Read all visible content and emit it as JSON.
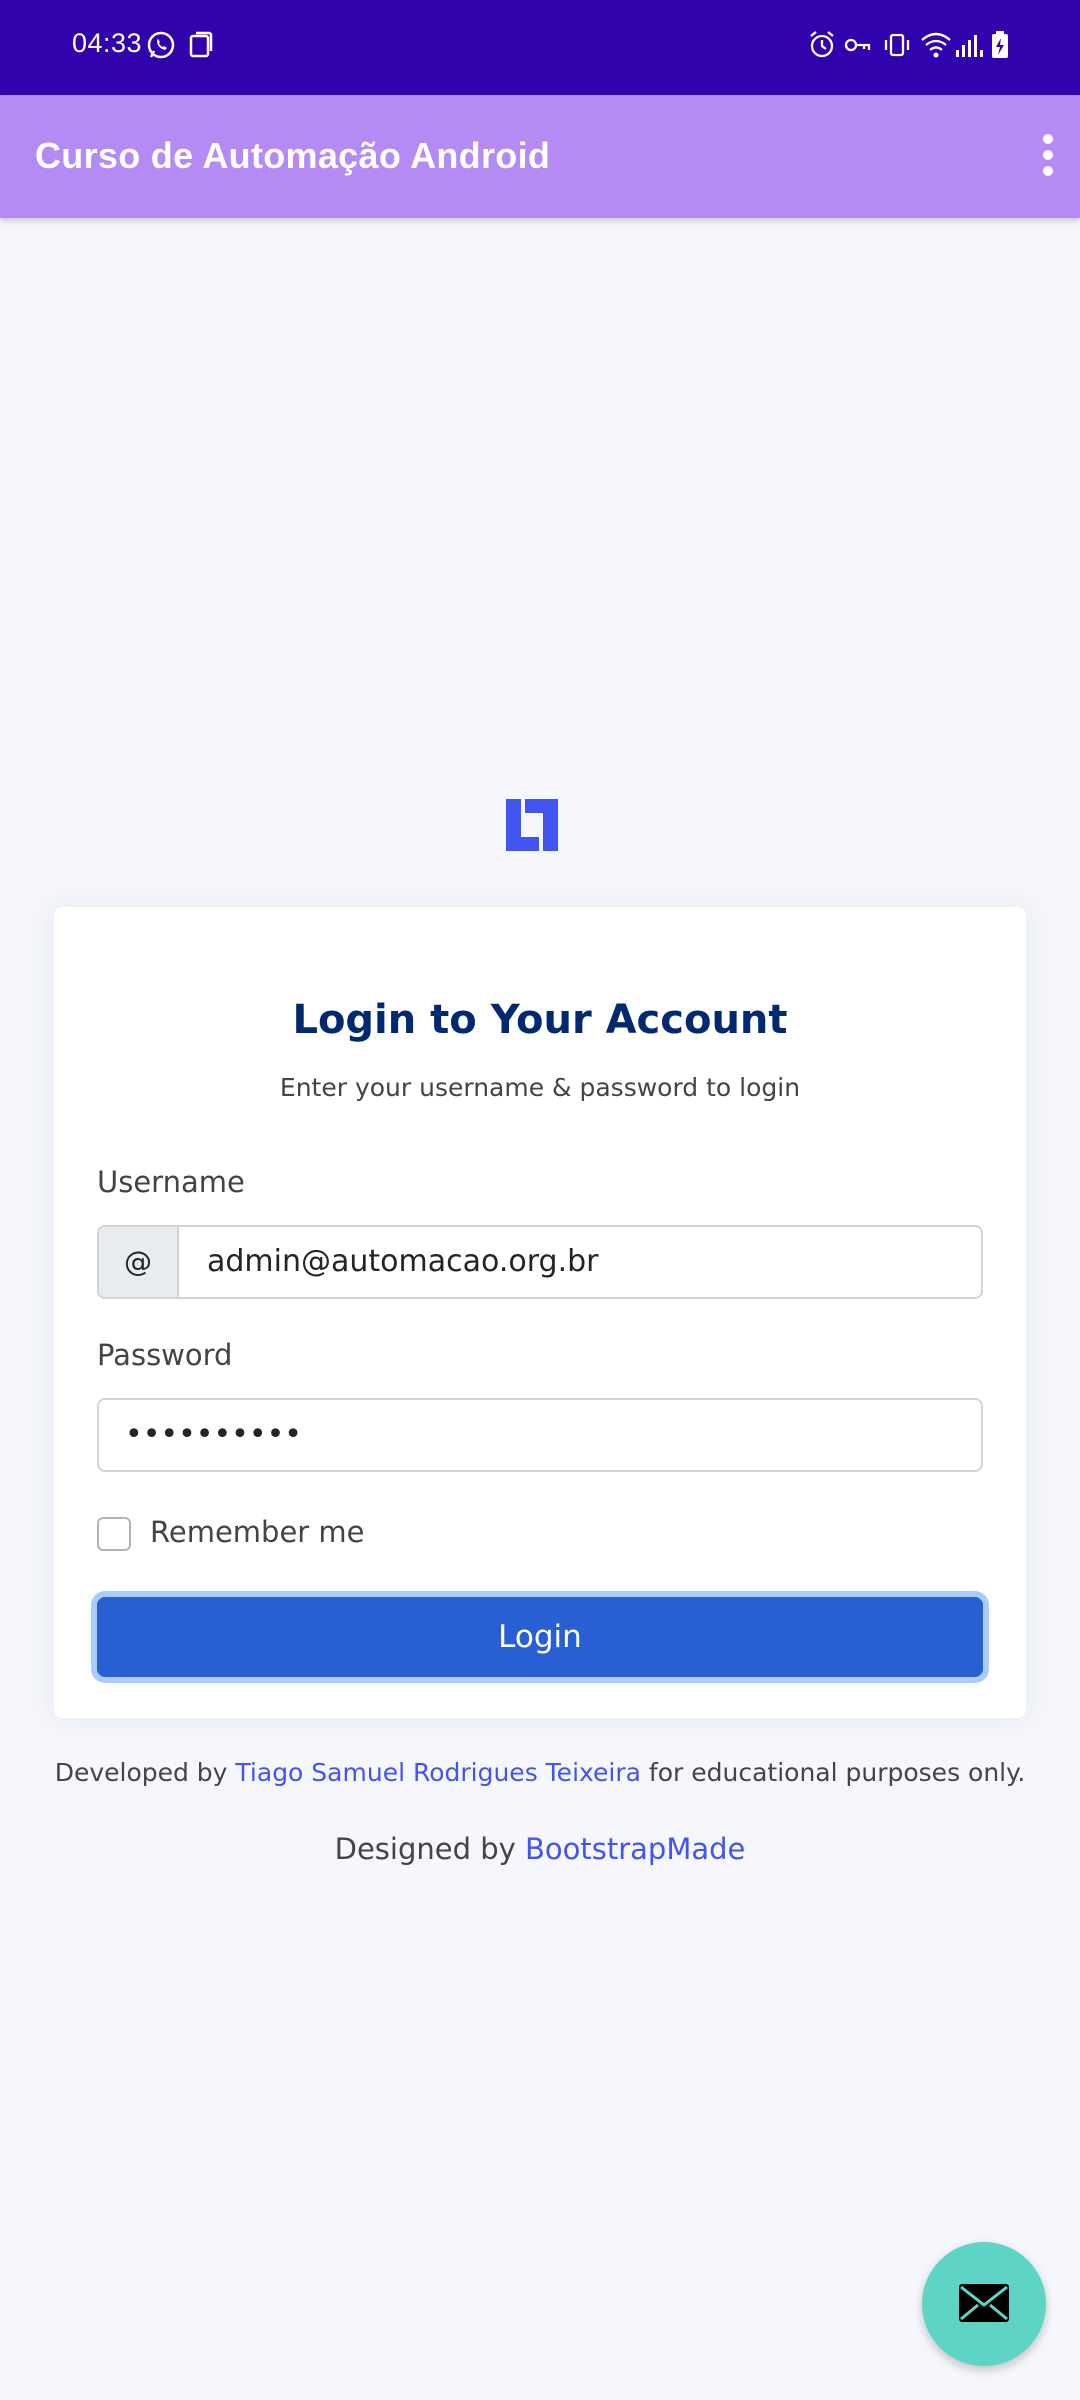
{
  "status_bar": {
    "time": "04:33",
    "left_icons": [
      "whatsapp-icon",
      "screenshot-icon"
    ],
    "right_icons": [
      "alarm-icon",
      "vpn-key-icon",
      "vibrate-icon",
      "wifi-icon",
      "signal-icon",
      "battery-charging-icon"
    ]
  },
  "app_bar": {
    "title": "Curso de Automação Android",
    "menu_icon": "more-vert-icon"
  },
  "login": {
    "logo_icon": "brand-logo-icon",
    "title": "Login to Your Account",
    "subtitle": "Enter your username & password to login",
    "username_label": "Username",
    "username_prefix": "@",
    "username_value": "admin@automacao.org.br",
    "password_label": "Password",
    "password_value": "••••••••••",
    "remember_label": "Remember me",
    "remember_checked": false,
    "login_button": "Login"
  },
  "footer": {
    "developed_prefix": "Developed by",
    "developer_name": "Tiago Samuel Rodrigues Teixeira",
    "developed_suffix": "for educational purposes only.",
    "designed_prefix": "Designed by",
    "designer_name": "BootstrapMade"
  },
  "fab": {
    "icon": "mail-icon"
  },
  "colors": {
    "status_bar": "#3003ad",
    "app_bar": "#b48af4",
    "title": "#012970",
    "button": "#2860d3",
    "link": "#4154f1",
    "fab": "#5ed4c4",
    "background": "#f5f7fc"
  }
}
